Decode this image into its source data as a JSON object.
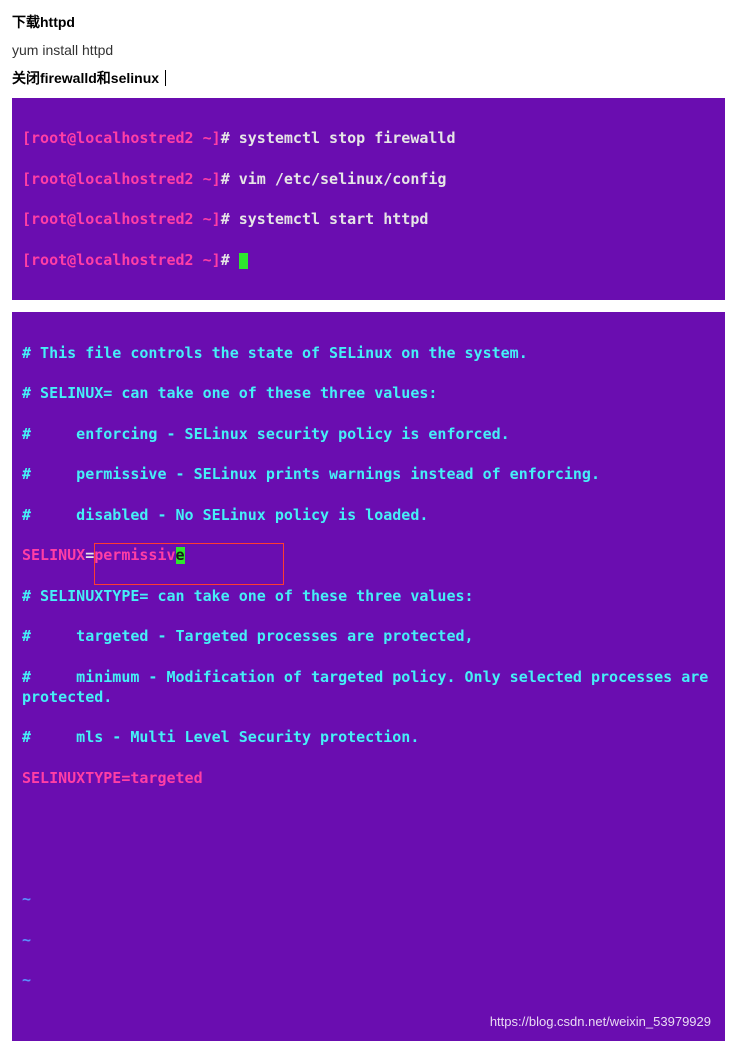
{
  "doc": {
    "heading1": "下载httpd",
    "commandText": "yum install httpd",
    "heading2": "关闭firewalld和selinux"
  },
  "term1": {
    "prompt": {
      "userhost": "[root@localhostred2 ~]",
      "symbol": "# "
    },
    "lines": [
      "systemctl stop firewalld",
      "vim /etc/selinux/config",
      "systemctl start httpd"
    ]
  },
  "term2": {
    "comments": [
      "# This file controls the state of SELinux on the system.",
      "# SELINUX= can take one of these three values:",
      "#     enforcing - SELinux security policy is enforced.",
      "#     permissive - SELinux prints warnings instead of enforcing.",
      "#     disabled - No SELinux policy is loaded."
    ],
    "selinux": {
      "key": "SELINUX",
      "eq": "=",
      "valuePrefix": "permissiv",
      "valueLast": "e"
    },
    "comments2": [
      "# SELINUXTYPE= can take one of these three values:",
      "#     targeted - Targeted processes are protected,",
      "#     minimum - Modification of targeted policy. Only selected processes are protected.",
      "#     mls - Multi Level Security protection."
    ],
    "selinuxtype": {
      "text": "SELINUXTYPE=targeted"
    },
    "tildes": [
      "~",
      "~",
      "~"
    ],
    "watermark": "https://blog.csdn.net/weixin_53979929"
  }
}
